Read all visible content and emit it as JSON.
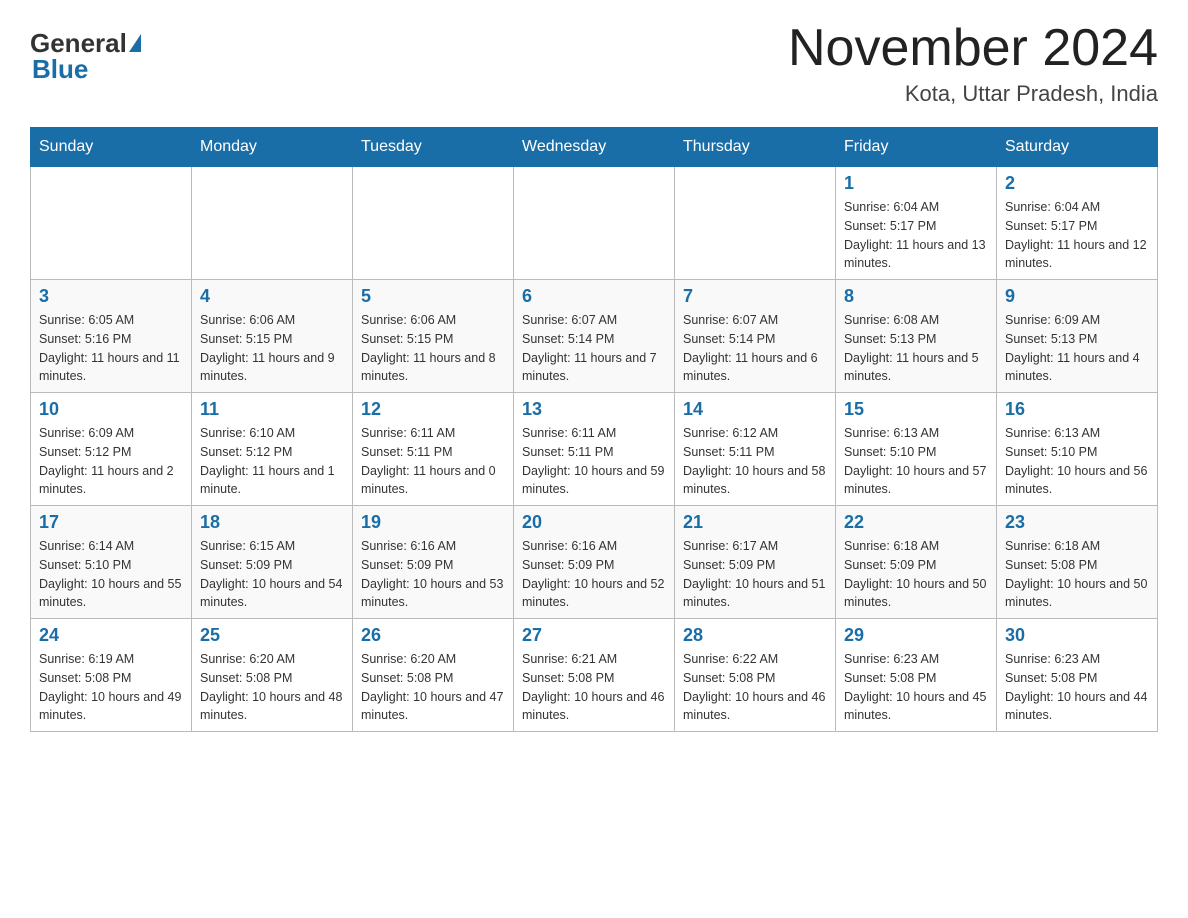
{
  "header": {
    "logo_general": "General",
    "logo_blue": "Blue",
    "month_title": "November 2024",
    "location": "Kota, Uttar Pradesh, India"
  },
  "calendar": {
    "days_of_week": [
      "Sunday",
      "Monday",
      "Tuesday",
      "Wednesday",
      "Thursday",
      "Friday",
      "Saturday"
    ],
    "weeks": [
      {
        "days": [
          {
            "number": "",
            "info": ""
          },
          {
            "number": "",
            "info": ""
          },
          {
            "number": "",
            "info": ""
          },
          {
            "number": "",
            "info": ""
          },
          {
            "number": "",
            "info": ""
          },
          {
            "number": "1",
            "info": "Sunrise: 6:04 AM\nSunset: 5:17 PM\nDaylight: 11 hours and 13 minutes."
          },
          {
            "number": "2",
            "info": "Sunrise: 6:04 AM\nSunset: 5:17 PM\nDaylight: 11 hours and 12 minutes."
          }
        ]
      },
      {
        "days": [
          {
            "number": "3",
            "info": "Sunrise: 6:05 AM\nSunset: 5:16 PM\nDaylight: 11 hours and 11 minutes."
          },
          {
            "number": "4",
            "info": "Sunrise: 6:06 AM\nSunset: 5:15 PM\nDaylight: 11 hours and 9 minutes."
          },
          {
            "number": "5",
            "info": "Sunrise: 6:06 AM\nSunset: 5:15 PM\nDaylight: 11 hours and 8 minutes."
          },
          {
            "number": "6",
            "info": "Sunrise: 6:07 AM\nSunset: 5:14 PM\nDaylight: 11 hours and 7 minutes."
          },
          {
            "number": "7",
            "info": "Sunrise: 6:07 AM\nSunset: 5:14 PM\nDaylight: 11 hours and 6 minutes."
          },
          {
            "number": "8",
            "info": "Sunrise: 6:08 AM\nSunset: 5:13 PM\nDaylight: 11 hours and 5 minutes."
          },
          {
            "number": "9",
            "info": "Sunrise: 6:09 AM\nSunset: 5:13 PM\nDaylight: 11 hours and 4 minutes."
          }
        ]
      },
      {
        "days": [
          {
            "number": "10",
            "info": "Sunrise: 6:09 AM\nSunset: 5:12 PM\nDaylight: 11 hours and 2 minutes."
          },
          {
            "number": "11",
            "info": "Sunrise: 6:10 AM\nSunset: 5:12 PM\nDaylight: 11 hours and 1 minute."
          },
          {
            "number": "12",
            "info": "Sunrise: 6:11 AM\nSunset: 5:11 PM\nDaylight: 11 hours and 0 minutes."
          },
          {
            "number": "13",
            "info": "Sunrise: 6:11 AM\nSunset: 5:11 PM\nDaylight: 10 hours and 59 minutes."
          },
          {
            "number": "14",
            "info": "Sunrise: 6:12 AM\nSunset: 5:11 PM\nDaylight: 10 hours and 58 minutes."
          },
          {
            "number": "15",
            "info": "Sunrise: 6:13 AM\nSunset: 5:10 PM\nDaylight: 10 hours and 57 minutes."
          },
          {
            "number": "16",
            "info": "Sunrise: 6:13 AM\nSunset: 5:10 PM\nDaylight: 10 hours and 56 minutes."
          }
        ]
      },
      {
        "days": [
          {
            "number": "17",
            "info": "Sunrise: 6:14 AM\nSunset: 5:10 PM\nDaylight: 10 hours and 55 minutes."
          },
          {
            "number": "18",
            "info": "Sunrise: 6:15 AM\nSunset: 5:09 PM\nDaylight: 10 hours and 54 minutes."
          },
          {
            "number": "19",
            "info": "Sunrise: 6:16 AM\nSunset: 5:09 PM\nDaylight: 10 hours and 53 minutes."
          },
          {
            "number": "20",
            "info": "Sunrise: 6:16 AM\nSunset: 5:09 PM\nDaylight: 10 hours and 52 minutes."
          },
          {
            "number": "21",
            "info": "Sunrise: 6:17 AM\nSunset: 5:09 PM\nDaylight: 10 hours and 51 minutes."
          },
          {
            "number": "22",
            "info": "Sunrise: 6:18 AM\nSunset: 5:09 PM\nDaylight: 10 hours and 50 minutes."
          },
          {
            "number": "23",
            "info": "Sunrise: 6:18 AM\nSunset: 5:08 PM\nDaylight: 10 hours and 50 minutes."
          }
        ]
      },
      {
        "days": [
          {
            "number": "24",
            "info": "Sunrise: 6:19 AM\nSunset: 5:08 PM\nDaylight: 10 hours and 49 minutes."
          },
          {
            "number": "25",
            "info": "Sunrise: 6:20 AM\nSunset: 5:08 PM\nDaylight: 10 hours and 48 minutes."
          },
          {
            "number": "26",
            "info": "Sunrise: 6:20 AM\nSunset: 5:08 PM\nDaylight: 10 hours and 47 minutes."
          },
          {
            "number": "27",
            "info": "Sunrise: 6:21 AM\nSunset: 5:08 PM\nDaylight: 10 hours and 46 minutes."
          },
          {
            "number": "28",
            "info": "Sunrise: 6:22 AM\nSunset: 5:08 PM\nDaylight: 10 hours and 46 minutes."
          },
          {
            "number": "29",
            "info": "Sunrise: 6:23 AM\nSunset: 5:08 PM\nDaylight: 10 hours and 45 minutes."
          },
          {
            "number": "30",
            "info": "Sunrise: 6:23 AM\nSunset: 5:08 PM\nDaylight: 10 hours and 44 minutes."
          }
        ]
      }
    ]
  }
}
